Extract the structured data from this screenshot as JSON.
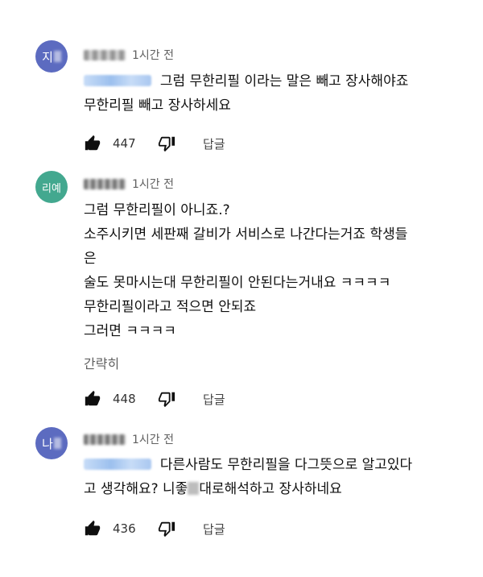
{
  "comments": [
    {
      "avatar": {
        "initial": "지",
        "color": "#5c6bc0"
      },
      "time": "1시간 전",
      "lines": [
        "그럼 무한리필 이라는 말은 빼고 장사해야죠",
        "무한리필 빼고 장사하세요"
      ],
      "likes": "447",
      "reply_label": "답글"
    },
    {
      "avatar": {
        "initial": "리예",
        "color": "#43a88f"
      },
      "time": "1시간 전",
      "lines": [
        "그럼 무한리필이 아니죠.?",
        "소주시키면 세판째 갈비가 서비스로 나간다는거죠 학생들",
        "은",
        "술도 못마시는대 무한리필이 안된다는거내요 ㅋㅋㅋㅋ",
        "무한리필이라고 적으면 안되죠",
        "그러면 ㅋㅋㅋㅋ"
      ],
      "read_more": "간략히",
      "likes": "448",
      "reply_label": "답글"
    },
    {
      "avatar": {
        "initial": "나",
        "color": "#5c6bc0"
      },
      "time": "1시간 전",
      "lines": [
        "다른사람도 무한리필을 다그뜻으로 알고있다",
        "고 생각해요? 니좋",
        "대로해석하고 장사하네요"
      ],
      "likes": "436",
      "reply_label": "답글"
    }
  ],
  "icons": {
    "like": "thumbs-up-icon",
    "dislike": "thumbs-down-icon"
  }
}
